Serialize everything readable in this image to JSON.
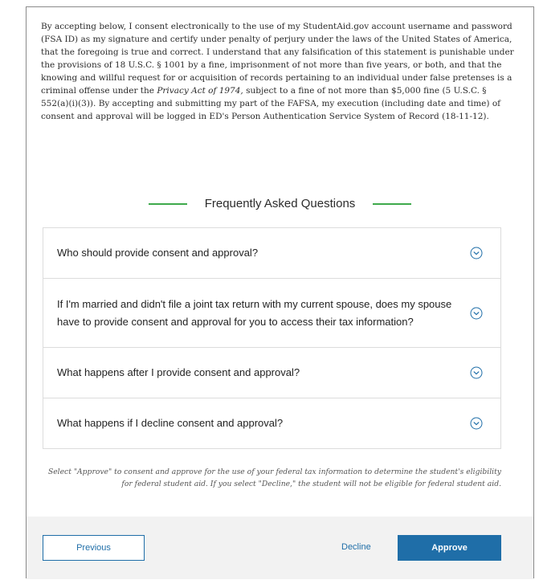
{
  "consent": {
    "paragraph_before_italic": "By accepting below, I consent electronically to the use of my StudentAid.gov account username and password (FSA ID) as my signature and certify under penalty of perjury under the laws of the United States of America, that the foregoing is true and correct. I understand that any falsification of this statement is punishable under the provisions of 18 U.S.C. § 1001 by a fine, imprisonment of not more than five years, or both, and that the knowing and willful request for or acquisition of records pertaining to an individual under false pretenses is a criminal offense under the ",
    "italic_act": "Privacy Act of 1974,",
    "paragraph_after_italic": " subject to a fine of not more than $5,000 fine (5 U.S.C. § 552(a)(i)(3)). By accepting and submitting my part of the FAFSA, my execution (including date and time) of consent and approval will be logged in ED's Person Authentication Service System of Record (18-11-12)."
  },
  "faq": {
    "heading": "Frequently Asked Questions",
    "accent_color": "#3ea94b",
    "items": [
      {
        "question": "Who should provide consent and approval?",
        "icon": "chevron-down-circle-icon"
      },
      {
        "question": "If I'm married and didn't file a joint tax return with my current spouse, does my spouse have to provide consent and approval for you to access their tax information?",
        "icon": "chevron-down-circle-icon"
      },
      {
        "question": "What happens after I provide consent and approval?",
        "icon": "chevron-down-circle-icon"
      },
      {
        "question": "What happens if I decline consent and approval?",
        "icon": "chevron-down-circle-icon"
      }
    ]
  },
  "note": {
    "text": "Select \"Approve\" to consent and approve for the use of your federal tax information to determine the student's eligibility for federal student aid. If you select \"Decline,\" the student will not be eligible for federal student aid."
  },
  "footer": {
    "previous_label": "Previous",
    "decline_label": "Decline",
    "approve_label": "Approve",
    "primary_color": "#1f6ea8"
  }
}
